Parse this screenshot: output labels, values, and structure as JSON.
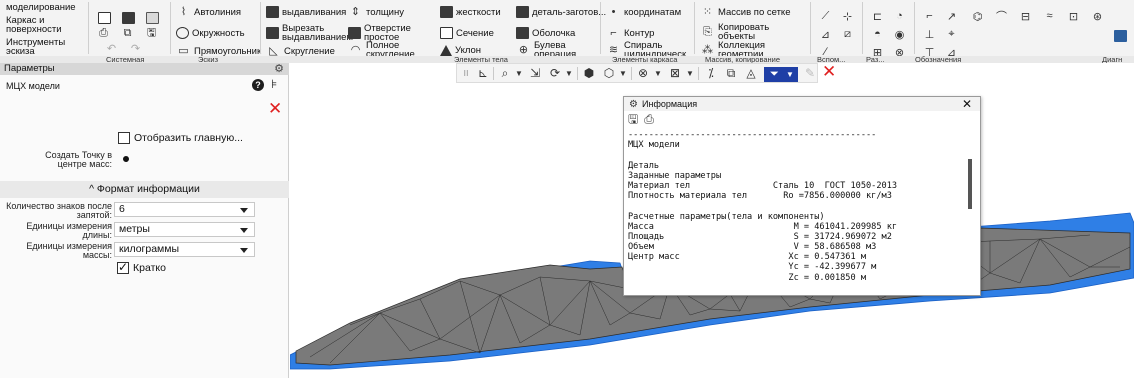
{
  "ribbon": {
    "items": [
      {
        "id": "r1",
        "label": "моделирование"
      },
      {
        "id": "r2",
        "label": "Каркас и поверхности"
      },
      {
        "id": "r3",
        "label": "Инструменты эскиза"
      },
      {
        "id": "r4",
        "label": "Автолиния"
      },
      {
        "id": "r5",
        "label": "Окружность"
      },
      {
        "id": "r6",
        "label": "Прямоугольник"
      },
      {
        "id": "r7",
        "label": "Скругление"
      },
      {
        "id": "r8",
        "label": "выдавливания"
      },
      {
        "id": "r9",
        "label": "Вырезать выдавливанием"
      },
      {
        "id": "r10",
        "label": "толщину"
      },
      {
        "id": "r11",
        "label": "Отверстие простое"
      },
      {
        "id": "r12",
        "label": "Полное скругление"
      },
      {
        "id": "r13",
        "label": "жесткости"
      },
      {
        "id": "r14",
        "label": "Сечение"
      },
      {
        "id": "r15",
        "label": "Уклон"
      },
      {
        "id": "r16",
        "label": "деталь-заготов..."
      },
      {
        "id": "r17",
        "label": "Оболочка"
      },
      {
        "id": "r18",
        "label": "Булева операция"
      },
      {
        "id": "r19",
        "label": "координатам"
      },
      {
        "id": "r20",
        "label": "Контур"
      },
      {
        "id": "r21",
        "label": "Спираль цилиндрическ..."
      },
      {
        "id": "r22",
        "label": "Массив по сетке"
      },
      {
        "id": "r23",
        "label": "Копировать объекты"
      },
      {
        "id": "r24",
        "label": "Коллекция геометрии"
      }
    ],
    "group_labels": {
      "sys": "Системная",
      "sketch": "Эскиз",
      "body": "Элементы тела",
      "frame": "Элементы каркаса",
      "array": "Массив, копирование",
      "aux": "Вспом...",
      "size": "Раз...",
      "notes": "Обозначения",
      "diag": "Диагн"
    }
  },
  "panel": {
    "header": "Параметры",
    "title": "МЦХ модели",
    "show_main_label": "Отобразить главную...",
    "create_point_label": "Создать Точку в центре масс:",
    "section_label": "^ Формат информации",
    "fields": [
      {
        "label": "Количество знаков после запятой:",
        "value": "6"
      },
      {
        "label": "Единицы измерения длины:",
        "value": "метры"
      },
      {
        "label": "Единицы измерения массы:",
        "value": "килограммы"
      }
    ],
    "brief_label": "Кратко"
  },
  "info": {
    "title": "Информация",
    "lines": [
      "------------------------------------------------",
      "МЦХ модели",
      "",
      "Деталь",
      "Заданные параметры",
      "Материал тел                Сталь 10  ГОСТ 1050-2013",
      "Плотность материала тел       Ro =7856.000000 кг/м3",
      "",
      "Расчетные параметры(тела и компоненты)",
      "Масса                           M = 461041.209985 кг",
      "Площадь                         S = 31724.969072 м2",
      "Объем                           V = 58.686508 м3",
      "Центр масс                     Xc = 0.547361 м",
      "                               Yc = -42.399677 м",
      "                               Zc = 0.001850 м"
    ]
  },
  "colors": {
    "accent_blue": "#1f3fa6",
    "mesh_gray": "#7a7a7a",
    "mesh_blue": "#2f7fe6",
    "close_red": "#e02020"
  }
}
